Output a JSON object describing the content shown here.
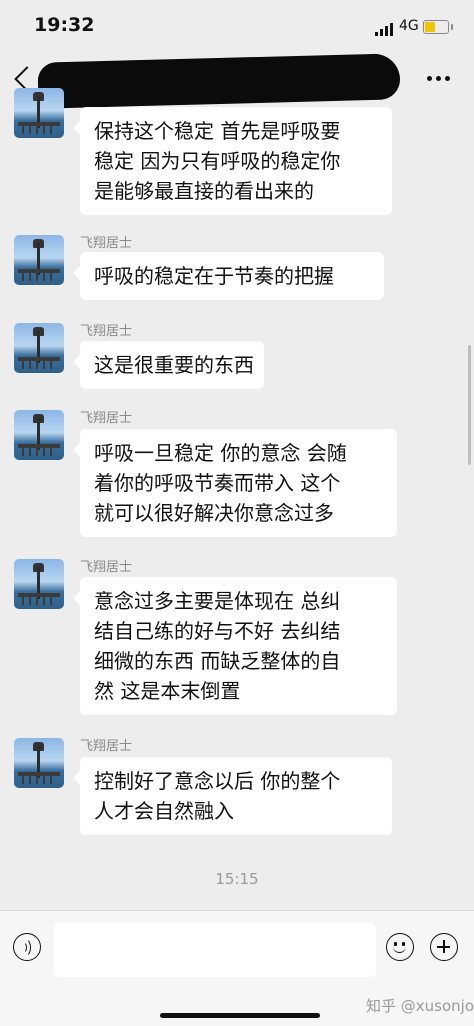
{
  "status_bar": {
    "time": "19:32",
    "network": "4G"
  },
  "chat": {
    "partner_name": "飞翔居士",
    "messages": [
      {
        "lines": [
          "保持这个稳定 首先是呼吸要",
          "稳定 因为只有呼吸的稳定你",
          "是能够最直接的看出来的"
        ]
      },
      {
        "lines": [
          "呼吸的稳定在于节奏的把握"
        ]
      },
      {
        "lines": [
          "这是很重要的东西"
        ]
      },
      {
        "lines": [
          "呼吸一旦稳定 你的意念 会随",
          "着你的呼吸节奏而带入 这个",
          "就可以很好解决你意念过多"
        ]
      },
      {
        "lines": [
          "意念过多主要是体现在 总纠",
          "结自己练的好与不好 去纠结",
          "细微的东西 而缺乏整体的自",
          "然 这是本末倒置"
        ]
      },
      {
        "lines": [
          "控制好了意念以后 你的整个",
          "人才会自然融入"
        ]
      }
    ],
    "timestamp": "15:15"
  },
  "input_bar": {
    "value": ""
  },
  "watermark": "知乎 @xusonjo",
  "colors": {
    "background": "#ededed",
    "bubble": "#ffffff",
    "battery": "#f2c400"
  }
}
